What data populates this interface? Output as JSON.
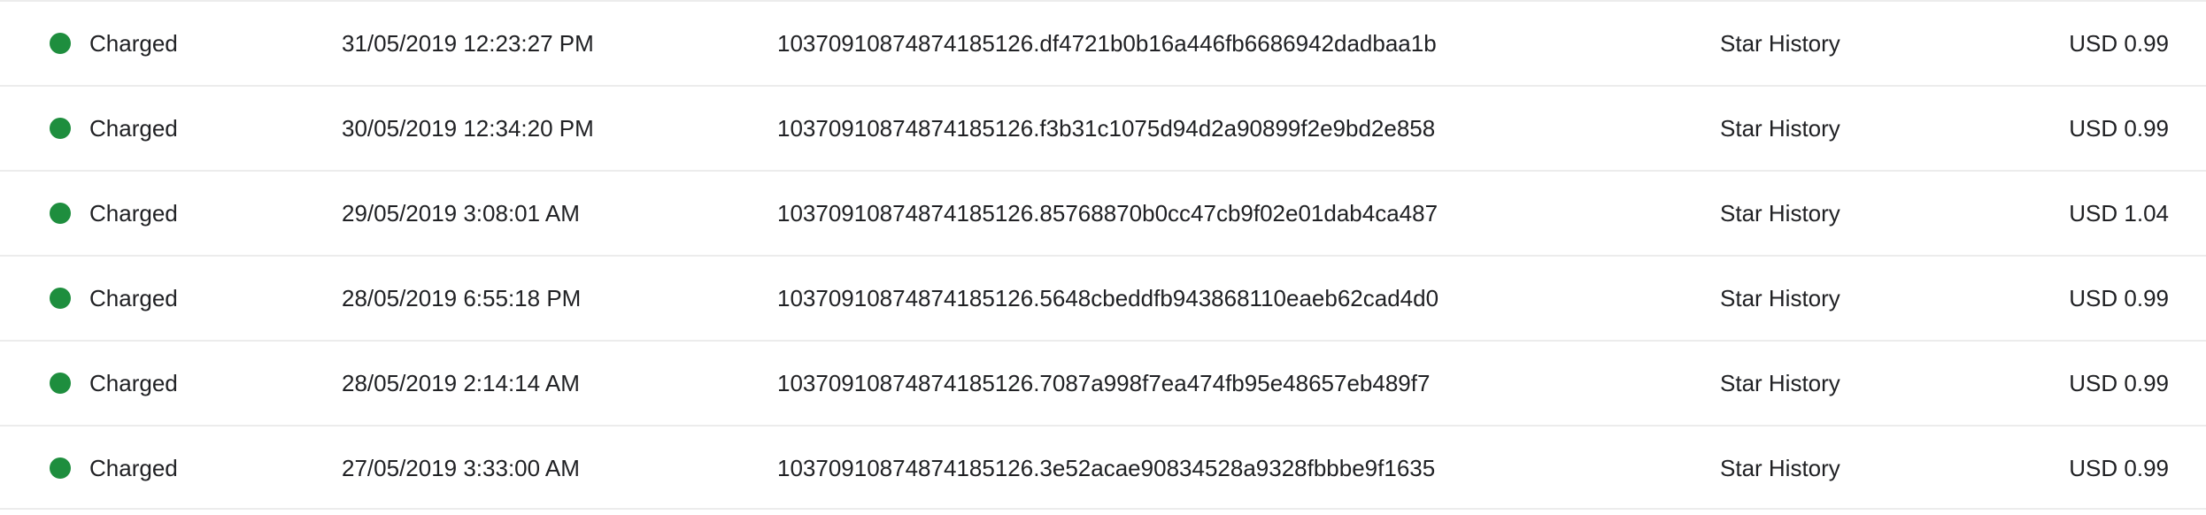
{
  "colors": {
    "status_charged": "#1e8e3e",
    "row_divider": "#ececec",
    "text": "#202124"
  },
  "orders": [
    {
      "status": "Charged",
      "date": "31/05/2019 12:23:27 PM",
      "order_id": "10370910874874185126.df4721b0b16a446fb6686942dadbaa1b",
      "product": "Star History",
      "amount": "USD 0.99"
    },
    {
      "status": "Charged",
      "date": "30/05/2019 12:34:20 PM",
      "order_id": "10370910874874185126.f3b31c1075d94d2a90899f2e9bd2e858",
      "product": "Star History",
      "amount": "USD 0.99"
    },
    {
      "status": "Charged",
      "date": "29/05/2019 3:08:01 AM",
      "order_id": "10370910874874185126.85768870b0cc47cb9f02e01dab4ca487",
      "product": "Star History",
      "amount": "USD 1.04"
    },
    {
      "status": "Charged",
      "date": "28/05/2019 6:55:18 PM",
      "order_id": "10370910874874185126.5648cbeddfb943868110eaeb62cad4d0",
      "product": "Star History",
      "amount": "USD 0.99"
    },
    {
      "status": "Charged",
      "date": "28/05/2019 2:14:14 AM",
      "order_id": "10370910874874185126.7087a998f7ea474fb95e48657eb489f7",
      "product": "Star History",
      "amount": "USD 0.99"
    },
    {
      "status": "Charged",
      "date": "27/05/2019 3:33:00 AM",
      "order_id": "10370910874874185126.3e52acae90834528a9328fbbbe9f1635",
      "product": "Star History",
      "amount": "USD 0.99"
    }
  ]
}
